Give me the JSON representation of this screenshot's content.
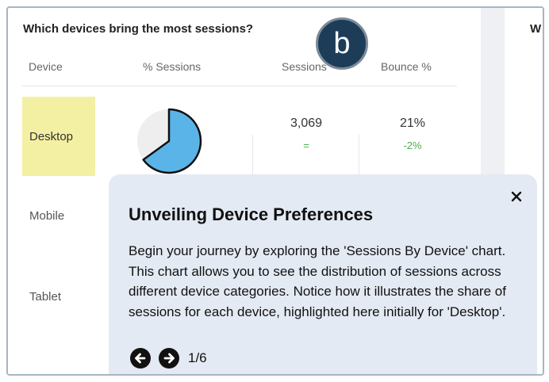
{
  "card": {
    "title": "Which devices bring the most sessions?",
    "columns": [
      "Device",
      "% Sessions",
      "Sessions",
      "Bounce %"
    ],
    "rows": [
      {
        "device": "Desktop",
        "sessions": "3,069",
        "sessions_change": "=",
        "bounce": "21%",
        "bounce_change": "-2%",
        "session_share": 0.65
      },
      {
        "device": "Mobile"
      },
      {
        "device": "Tablet"
      }
    ]
  },
  "right_card": {
    "title": "W"
  },
  "badge": {
    "label": "b"
  },
  "popup": {
    "title": "Unveiling Device Preferences",
    "body": "Begin your journey by exploring the 'Sessions By Device' chart. This chart allows you to see the distribution of sessions across different device categories. Notice how it illustrates the share of sessions for each device, highlighted here initially for 'Desktop'.",
    "step": "1/6"
  },
  "colors": {
    "pie_fill": "#5bb4e8",
    "pie_bg": "#eeeeee",
    "highlight": "#f4f0a3",
    "positive": "#4caf50"
  }
}
